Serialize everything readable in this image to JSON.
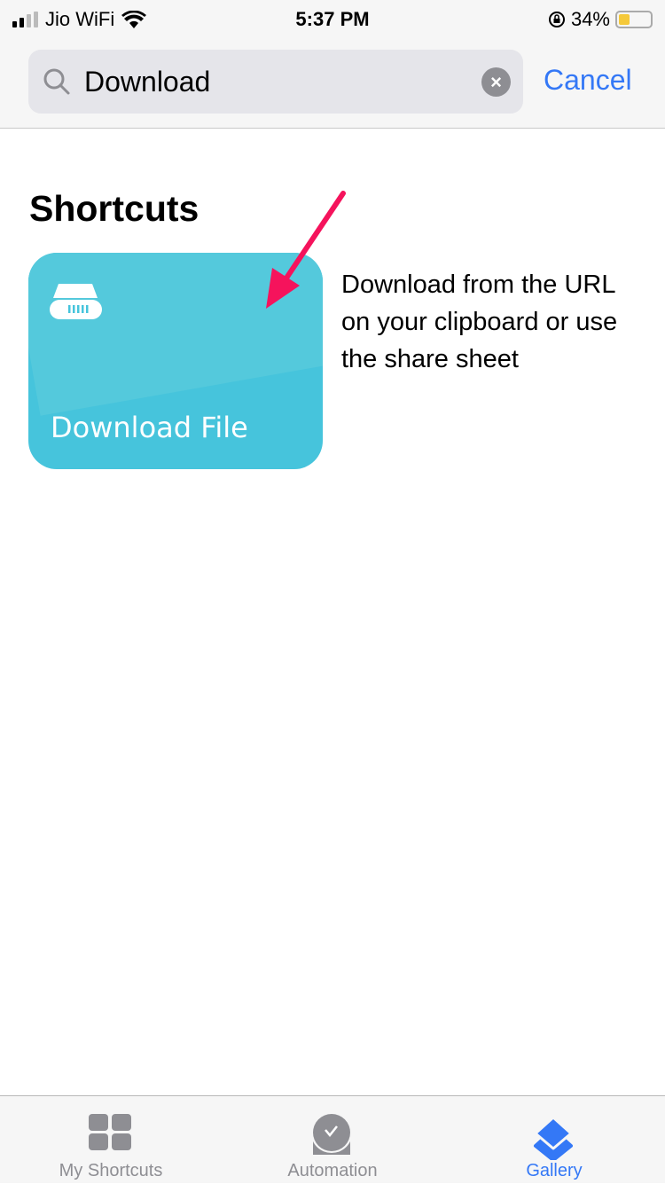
{
  "status_bar": {
    "carrier": "Jio WiFi",
    "time": "5:37 PM",
    "battery": "34%",
    "battery_level": 0.34
  },
  "search": {
    "value": "Download",
    "cancel_label": "Cancel"
  },
  "section_title": "Shortcuts",
  "shortcut": {
    "name": "Download File",
    "description": "Download from the URL on your clipboard or use the share sheet",
    "color": "#46c4dc",
    "icon": "hard-drive-icon"
  },
  "annotation": {
    "color": "#f5135c"
  },
  "tabs": [
    {
      "label": "My Shortcuts",
      "icon": "grid-icon"
    },
    {
      "label": "Automation",
      "icon": "clock-check-icon"
    },
    {
      "label": "Gallery",
      "icon": "layers-icon",
      "active": true
    }
  ],
  "accent": "#3478f6"
}
